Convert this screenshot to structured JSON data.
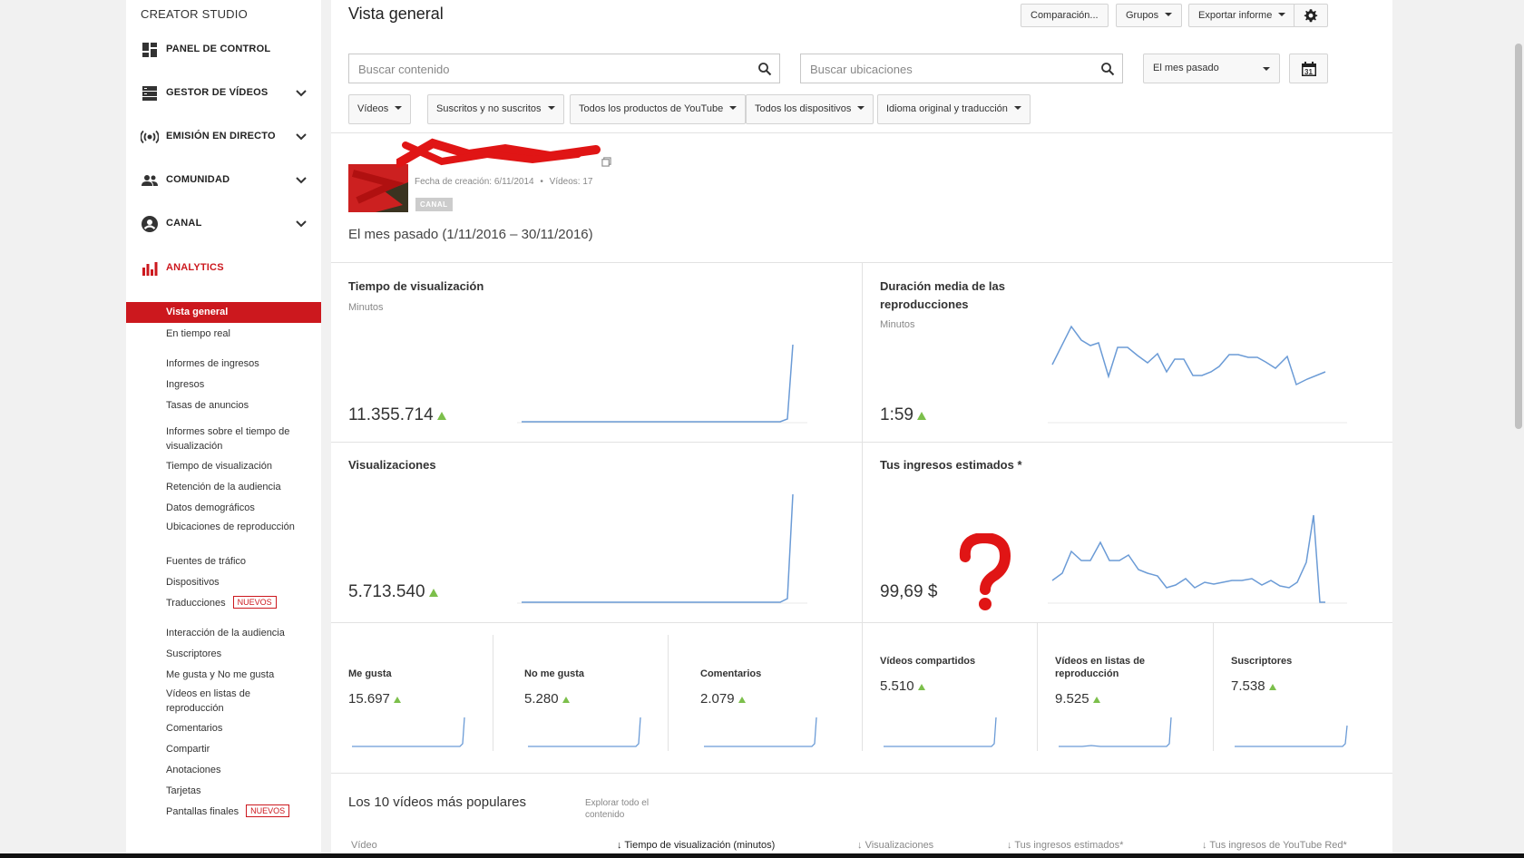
{
  "sidebar": {
    "brand": "CREATOR STUDIO",
    "items": [
      {
        "label": "PANEL DE CONTROL",
        "icon": "dashboard-icon"
      },
      {
        "label": "GESTOR DE VÍDEOS",
        "icon": "video-manager-icon"
      },
      {
        "label": "EMISIÓN EN DIRECTO",
        "icon": "live-broadcast-icon"
      },
      {
        "label": "COMUNIDAD",
        "icon": "community-icon"
      },
      {
        "label": "CANAL",
        "icon": "channel-icon"
      },
      {
        "label": "ANALYTICS",
        "icon": "analytics-icon"
      }
    ],
    "analytics_sub": [
      {
        "label": "Vista general"
      },
      {
        "label": "En tiempo real"
      },
      {
        "label": "Informes de ingresos"
      },
      {
        "label": "Ingresos"
      },
      {
        "label": "Tasas de anuncios"
      },
      {
        "label": "Informes sobre el tiempo de visualización"
      },
      {
        "label": "Tiempo de visualización"
      },
      {
        "label": "Retención de la audiencia"
      },
      {
        "label": "Datos demográficos"
      },
      {
        "label": "Ubicaciones de reproducción"
      },
      {
        "label": "Fuentes de tráfico"
      },
      {
        "label": "Dispositivos"
      },
      {
        "label": "Traducciones",
        "badge": "NUEVOS"
      },
      {
        "label": "Interacción de la audiencia"
      },
      {
        "label": "Suscriptores"
      },
      {
        "label": "Me gusta y No me gusta"
      },
      {
        "label": "Vídeos en listas de reproducción"
      },
      {
        "label": "Comentarios"
      },
      {
        "label": "Compartir"
      },
      {
        "label": "Anotaciones"
      },
      {
        "label": "Tarjetas"
      },
      {
        "label": "Pantallas finales",
        "badge": "NUEVOS"
      }
    ]
  },
  "header": {
    "title": "Vista general",
    "buttons": {
      "compare": "Comparación...",
      "groups": "Grupos",
      "export": "Exportar informe"
    },
    "search_content_placeholder": "Buscar contenido",
    "search_locations_placeholder": "Buscar ubicaciones",
    "date_select": "El mes pasado",
    "calendar_day": "31",
    "filters": [
      "Vídeos",
      "Suscritos y no suscritos",
      "Todos los productos de YouTube",
      "Todos los dispositivos",
      "Idioma original y traducción"
    ]
  },
  "channel": {
    "meta_created": "Fecha de creación: 6/11/2014",
    "meta_sep": "•",
    "meta_videos": "Vídeos: 17",
    "badge": "CANAL",
    "period": "El mes pasado (1/11/2016 – 30/11/2016)"
  },
  "metrics": {
    "watch_time": {
      "title": "Tiempo de visualización",
      "unit": "Minutos",
      "value": "11.355.714"
    },
    "avg_duration": {
      "title": "Duración media de las reproducciones",
      "unit": "Minutos",
      "value": "1:59"
    },
    "views": {
      "title": "Visualizaciones",
      "value": "5.713.540"
    },
    "earnings": {
      "title": "Tus ingresos estimados *",
      "value": "99,69 $"
    }
  },
  "mini_metrics": [
    {
      "title": "Me gusta",
      "value": "15.697"
    },
    {
      "title": "No me gusta",
      "value": "5.280"
    },
    {
      "title": "Comentarios",
      "value": "2.079"
    },
    {
      "title": "Vídeos compartidos",
      "value": "5.510"
    },
    {
      "title": "Vídeos en listas de reproducción",
      "value": "9.525"
    },
    {
      "title": "Suscriptores",
      "value": "7.538"
    }
  ],
  "top_videos": {
    "title": "Los 10 vídeos más populares",
    "explore": "Explorar todo el contenido",
    "columns": [
      "Vídeo",
      "Tiempo de visualización (minutos)",
      "Visualizaciones",
      "Tus ingresos estimados*",
      "Tus ingresos de YouTube Red*"
    ]
  },
  "colors": {
    "accent": "#cc181e",
    "line": "#6b9bd6",
    "up": "#7cbf4b"
  }
}
